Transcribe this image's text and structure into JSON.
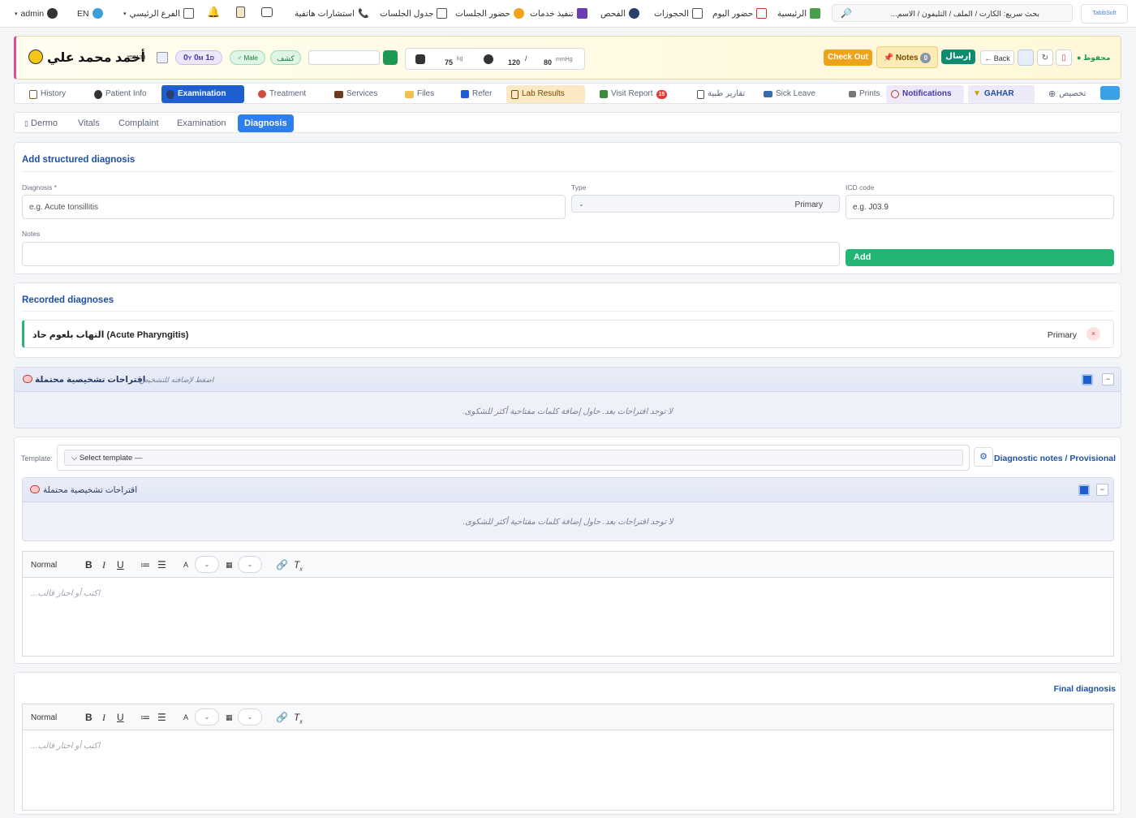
{
  "topbar": {
    "logo": "TabibSoft",
    "search_label": "بحث سريع: الكارت / الملف / التليفون / الاسم...",
    "nav": [
      "الرئيسية",
      "حضور اليوم",
      "الحجوزات",
      "الفحص",
      "تنفيذ خدمات",
      "حضور الجلسات",
      "جدول الجلسات",
      "استشارات هاتفية"
    ],
    "branch": "الفرع الرئيسي",
    "lang": "EN",
    "user": "admin"
  },
  "patient": {
    "name": "أحمد محمد علي",
    "id": "#50138",
    "age_y": "0",
    "age_m": "0",
    "age_d": "1",
    "age_y_unit": "Y",
    "age_m_unit": "M",
    "age_d_unit": "D",
    "gender": "♂ Male",
    "visit_type": "كشف",
    "weight": "75",
    "weight_unit": "kg",
    "bp_sys": "120",
    "bp_dia": "80",
    "bp_unit": "mmHg",
    "checkout": "Check Out",
    "notes": "Notes",
    "notes_count": "0",
    "send": "إرسال",
    "back": "← Back",
    "saved": "محفوظ"
  },
  "tabs": [
    "History",
    "Patient Info",
    "Examination",
    "Treatment",
    "Services",
    "Files",
    "Refer",
    "Lab Results",
    "Visit Report",
    "تقارير طبية",
    "Sick Leave",
    "Prints",
    "Notifications",
    "GAHAR",
    "تخصيص"
  ],
  "visit_report_badge": "15",
  "subtabs": [
    "Dermo",
    "Vitals",
    "Complaint",
    "Examination",
    "Diagnosis"
  ],
  "structured": {
    "title": "Add structured diagnosis",
    "diagnosis_label": "Diagnosis *",
    "diagnosis_placeholder": "e.g. Acute tonsillitis",
    "type_label": "Type",
    "type_value": "Primary",
    "icd_label": "ICD code",
    "icd_placeholder": "e.g. J03.9",
    "notes_label": "Notes",
    "add": "Add"
  },
  "recorded": {
    "title": "Recorded diagnoses",
    "items": [
      {
        "name": "التهاب بلعوم حاد (Acute Pharyngitis)",
        "type": "Primary"
      }
    ]
  },
  "suggestions": {
    "title": "اقتراحات تشخيصية محتملة",
    "hint": "اضغط لإضافته للتشخيص",
    "empty": "لا توجد اقتراحات بعد. حاول إضافة كلمات مفتاحية أكثر للشكوى."
  },
  "provisional": {
    "template_label": "Template:",
    "template_value": "Select template —",
    "title": "Diagnostic notes / Provisional",
    "format": "Normal",
    "placeholder": "اكتب أو اختار قالب..."
  },
  "final": {
    "title": "Final diagnosis",
    "format": "Normal",
    "placeholder": "اكتب أو اختار قالب..."
  },
  "colors": {
    "primary": "#1d5fd1",
    "success": "#22b573",
    "accent": "#f0a21a"
  }
}
